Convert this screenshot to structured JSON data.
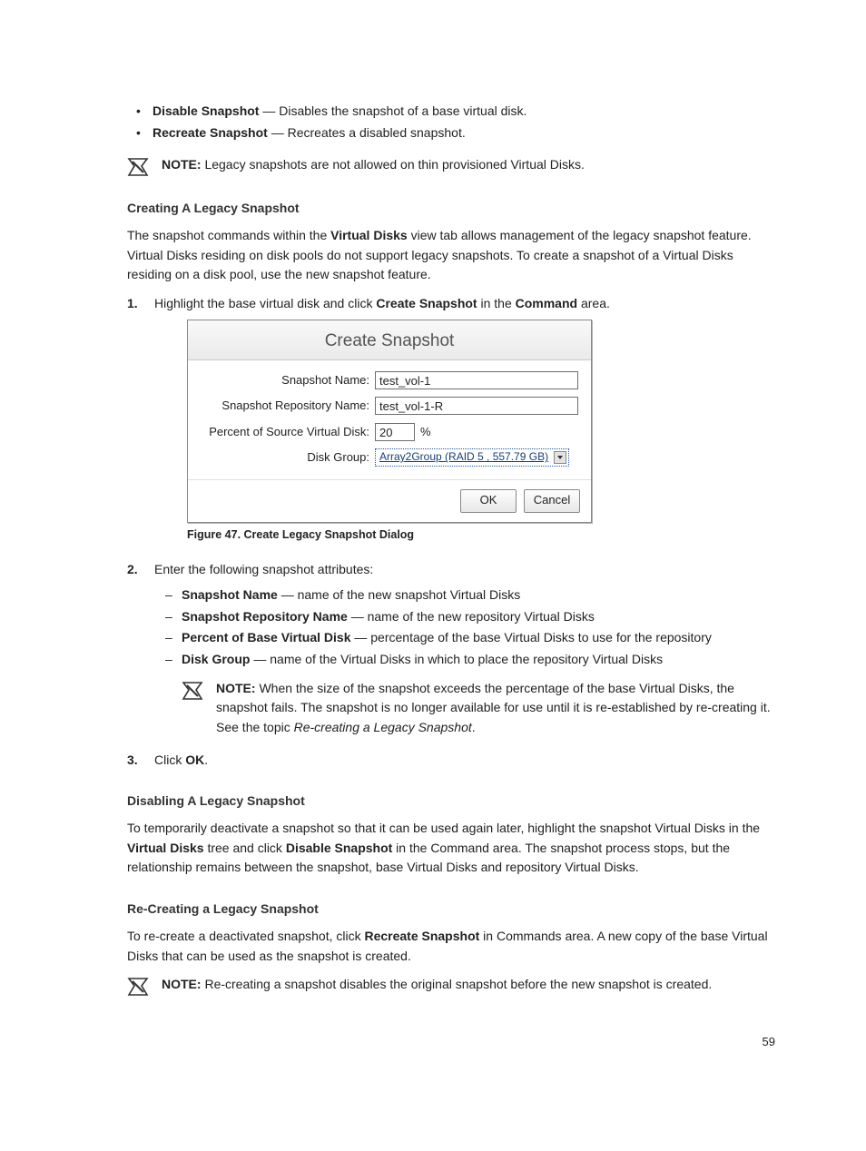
{
  "pageNumber": "59",
  "bullets": [
    {
      "term": "Disable Snapshot",
      "desc": " — Disables the snapshot of a base virtual disk."
    },
    {
      "term": "Recreate Snapshot",
      "desc": " — Recreates a disabled snapshot."
    }
  ],
  "note1": {
    "label": "NOTE:",
    "text": " Legacy snapshots are not allowed on thin provisioned Virtual Disks."
  },
  "h1": "Creating A Legacy Snapshot",
  "p1_a": "The snapshot commands within the ",
  "p1_b": "Virtual Disks",
  "p1_c": " view tab allows management of the legacy snapshot feature. Virtual Disks residing on disk pools do not support legacy snapshots. To create a snapshot of a Virtual Disks residing on a disk pool, use the new snapshot feature.",
  "step1": {
    "num": "1.",
    "a": "Highlight the base virtual disk and click ",
    "b": "Create Snapshot",
    "c": " in the ",
    "d": "Command",
    "e": " area."
  },
  "dialog": {
    "title": "Create Snapshot",
    "snapName_label": "Snapshot Name:",
    "snapName_value": "test_vol-1",
    "repoName_label": "Snapshot Repository Name:",
    "repoName_value": "test_vol-1-R",
    "percent_label": "Percent of Source Virtual Disk:",
    "percent_value": "20",
    "percent_unit": "%",
    "diskGroup_label": "Disk Group:",
    "diskGroup_value": "Array2Group (RAID 5 , 557.79 GB)",
    "ok": "OK",
    "cancel": "Cancel"
  },
  "caption1": "Figure 47. Create Legacy Snapshot Dialog",
  "step2": {
    "num": "2.",
    "text": "Enter the following snapshot attributes:",
    "attrs": [
      {
        "term": "Snapshot Name",
        "desc": " — name of the new snapshot Virtual Disks"
      },
      {
        "term": "Snapshot Repository Name",
        "desc": " — name of the new repository Virtual Disks"
      },
      {
        "term": "Percent of Base Virtual Disk",
        "desc": " — percentage of the base Virtual Disks to use for the repository"
      },
      {
        "term": "Disk Group",
        "desc": " — name of the Virtual Disks in which to place the repository Virtual Disks"
      }
    ],
    "note": {
      "label": "NOTE:",
      "a": " When the size of the snapshot exceeds the percentage of the base Virtual Disks, the snapshot fails. The snapshot is no longer available for use until it is re-established by re-creating it. See the topic ",
      "i": "Re-creating a Legacy Snapshot",
      "b": "."
    }
  },
  "step3": {
    "num": "3.",
    "a": "Click ",
    "b": "OK",
    "c": "."
  },
  "h2": "Disabling A Legacy Snapshot",
  "p2_a": "To temporarily deactivate a snapshot so that it can be used again later, highlight the snapshot Virtual Disks in the ",
  "p2_b": "Virtual Disks",
  "p2_c": " tree and click ",
  "p2_d": "Disable Snapshot",
  "p2_e": " in the Command area. The snapshot process stops, but the relationship remains between the snapshot, base Virtual Disks and repository Virtual Disks.",
  "h3": "Re-Creating a Legacy Snapshot",
  "p3_a": "To re-create a deactivated snapshot, click ",
  "p3_b": "Recreate Snapshot",
  "p3_c": " in Commands area. A new copy of the base Virtual Disks that can be used as the snapshot is created.",
  "note3": {
    "label": "NOTE:",
    "text": " Re-creating a snapshot disables the original snapshot before the new snapshot is created."
  }
}
